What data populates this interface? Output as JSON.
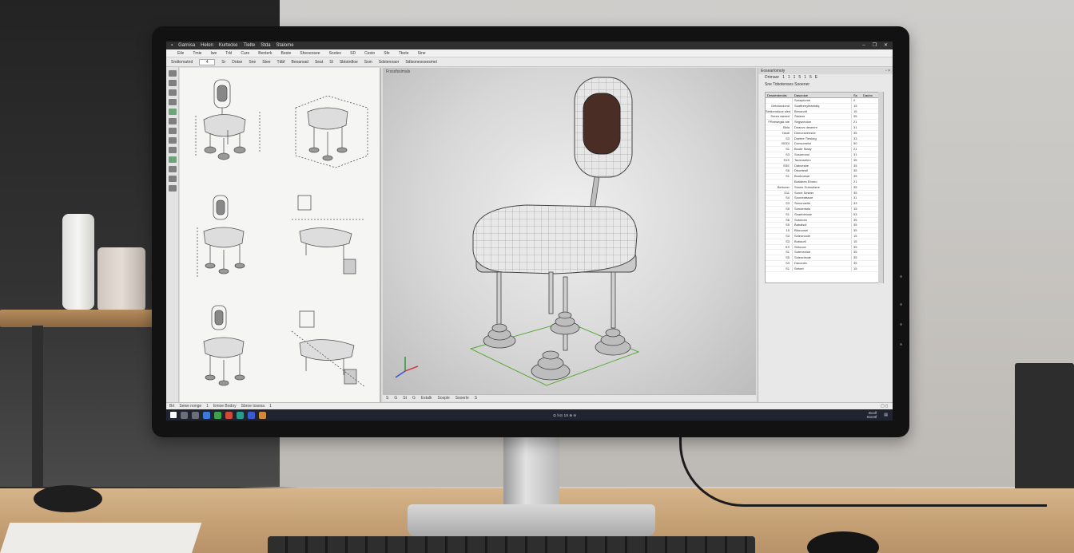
{
  "app": {
    "title_items": [
      "Garnisa",
      "Helon",
      "Kurtecke",
      "Tlelte",
      "Stda",
      "Stalome"
    ],
    "window_controls": [
      "–",
      "❐",
      "✕"
    ]
  },
  "menubar": [
    "Eile",
    "Tmie",
    "Iwe",
    "Trkl",
    "Cure",
    "Benterk",
    "Beste",
    "Sheoeosee",
    "Sootec",
    "SD",
    "Cesto",
    "Sfe",
    "Tbote",
    "Sine"
  ],
  "toolbar": {
    "items": [
      "Sndtoroutnd",
      "4",
      "Sr",
      "Dotse",
      "Sne",
      "Stee",
      "Tdbf",
      "Beoarsad",
      "Seat",
      "SI",
      "Sbtotrdloe",
      "Ssm",
      "Sdstenoaor",
      "Sdtsonesosesmel"
    ]
  },
  "viewport": {
    "label": "Frsssfssimals",
    "status": [
      "S",
      "G",
      "St",
      "G",
      "Estalk",
      "Sosple",
      "Ssoerle",
      "S"
    ]
  },
  "properties": {
    "title": "Eosearlomoly",
    "tools": [
      "Drtmaor",
      "1",
      "1",
      "1",
      "5",
      "1",
      "5",
      "E"
    ],
    "subtitle": "Sne Tobotenses  Sooener",
    "headers": [
      "Desderdmolis",
      "Dascrdoe",
      "Ss",
      "Daubo"
    ],
    "rows": [
      [
        "",
        "Soseplume",
        "0"
      ],
      [
        "Detdonolond",
        "Soaftreeyiearbdiq",
        "15"
      ],
      [
        "Setdomdooe.uled",
        "Benaonlt",
        "15"
      ],
      [
        "Sreen.esieed",
        "Sistene",
        "35"
      ],
      [
        "FReesegsk ste",
        "Segsneoloe",
        "21"
      ],
      [
        "Bbla",
        "Deacvs desenre",
        "31"
      ],
      [
        "Tandl",
        "Deeceseensoe",
        "35"
      ],
      [
        "S3",
        "Dsefee Tleskeg",
        "33"
      ],
      [
        "BGDI",
        "Donsomelol",
        "50"
      ],
      [
        "S1",
        "Boote Stasy",
        "21"
      ],
      [
        "S3",
        "Sosoeonol",
        "31"
      ],
      [
        "S1S",
        "Taoeoseteo",
        "35"
      ],
      [
        "SSE",
        "Dabcesbe",
        "35"
      ],
      [
        "S6",
        "Dboetestl",
        "35"
      ],
      [
        "S1",
        "Bonboesal",
        "35"
      ],
      [
        "",
        "Botidees Eforeo",
        "21"
      ],
      [
        "Bertonsr",
        "Sones Dobnotsne",
        "35"
      ],
      [
        "S11",
        "Sonot Seseer",
        "35"
      ],
      [
        "S4",
        "Sooneatssoe",
        "31"
      ],
      [
        "S3",
        "Senonoelle",
        "33"
      ],
      [
        "S5",
        "Sonoentols",
        "15"
      ],
      [
        "S1",
        "Seaeblelose",
        "53"
      ],
      [
        "S6",
        "Sutobolo",
        "35"
      ],
      [
        "S5",
        "Babalsdl",
        "35"
      ],
      [
        "15",
        "Blaccosel",
        "35"
      ],
      [
        "S3",
        "Soleonoole",
        "15"
      ],
      [
        "S3",
        "Bobaorll",
        "15"
      ],
      [
        "SS",
        "Setooce",
        "35"
      ],
      [
        "S1",
        "Soteneoloe",
        "35"
      ],
      [
        "S5",
        "Soleuntsole",
        "35"
      ],
      [
        "S3",
        "Dacooes",
        "35"
      ],
      [
        "S1",
        "Setoet",
        "15"
      ]
    ]
  },
  "statusbar": {
    "items": [
      "Brt",
      "Sewe nonge",
      "1",
      "Emoe Bodoy",
      "Sbroe tosesa",
      "1"
    ],
    "right": "▢ ▯"
  },
  "taskbar": {
    "clock_time": "Boolf",
    "clock_date": "Stosttf",
    "tray": "Ω  ℕ⊙ 1S ⊕ ⊖"
  }
}
